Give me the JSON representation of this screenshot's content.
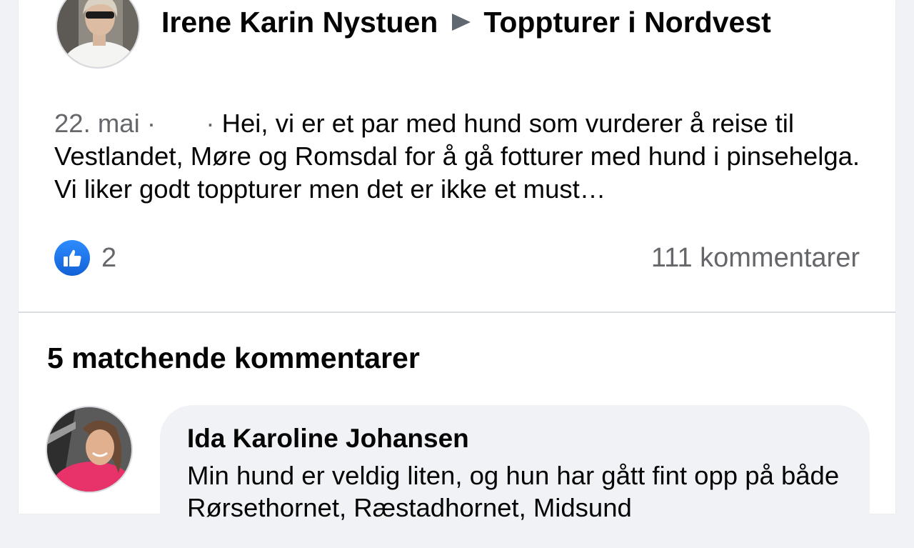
{
  "post": {
    "author": "Irene Karin Nystuen",
    "group": "Toppturer i Nordvest",
    "date": "22. mai",
    "separator": "·",
    "text": "Hei, vi er et par med hund som vurderer å reise til Vestlandet, Møre og Romsdal for å gå fotturer med hund i pinsehelga. Vi liker godt toppturer men det er ikke et must…",
    "likes": "2",
    "comments": "111 kommentarer"
  },
  "matches": {
    "title": "5 matchende kommentarer"
  },
  "comment": {
    "author": "Ida Karoline Johansen",
    "text": "Min hund er veldig liten, og hun har gått fint opp på både Rørsethornet, Ræstadhornet, Midsund"
  },
  "colors": {
    "like_blue": "#1877f2",
    "meta_gray": "#65676b",
    "bubble_bg": "#f0f2f5"
  }
}
